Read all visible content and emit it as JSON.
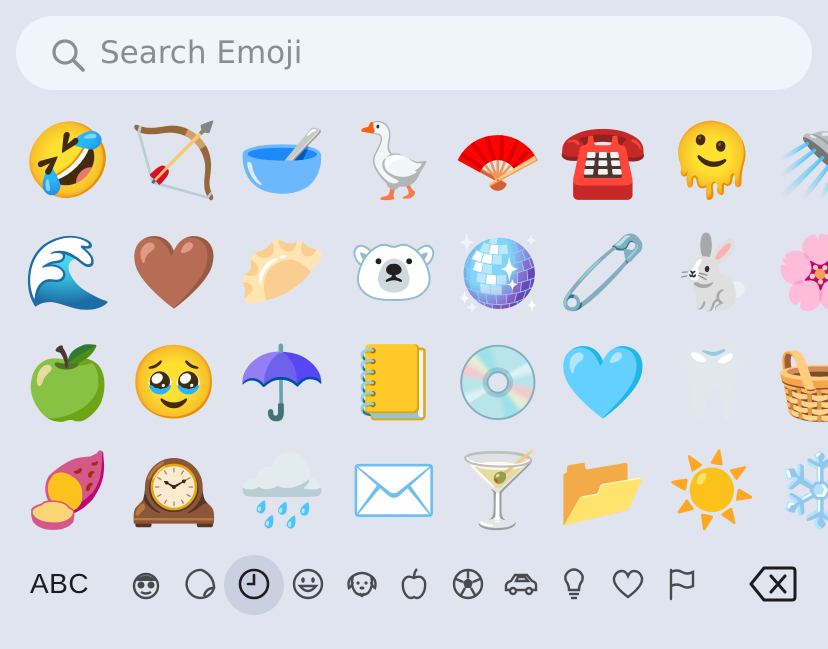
{
  "search": {
    "placeholder": "Search Emoji"
  },
  "emoji_grid": {
    "rows": [
      [
        "🤣",
        "🏹",
        "🥣",
        "🪿",
        "🪭",
        "☎️",
        "🫠",
        "🚿"
      ],
      [
        "🌊",
        "🤎",
        "🥟",
        "🐻‍❄️",
        "🪩",
        "🧷",
        "🐇",
        "🌸"
      ],
      [
        "🍏",
        "🥹",
        "☂️",
        "📒",
        "💿",
        "🩵",
        "🦷",
        "🧺"
      ],
      [
        "🍠",
        "🕰️",
        "🌧️",
        "✉️",
        "🍸",
        "📂",
        "☀️",
        "❄️"
      ]
    ]
  },
  "categories": {
    "abc_label": "ABC",
    "items": [
      {
        "name": "smileys-people",
        "icon": "person-face-icon"
      },
      {
        "name": "stickers",
        "icon": "sticker-icon"
      },
      {
        "name": "frequently-used",
        "icon": "clock-icon",
        "selected": true
      },
      {
        "name": "smileys",
        "icon": "smiley-icon"
      },
      {
        "name": "animals-nature",
        "icon": "dog-icon"
      },
      {
        "name": "food-drink",
        "icon": "apple-icon"
      },
      {
        "name": "activity",
        "icon": "soccer-ball-icon"
      },
      {
        "name": "travel-places",
        "icon": "car-icon"
      },
      {
        "name": "objects",
        "icon": "lightbulb-icon"
      },
      {
        "name": "symbols",
        "icon": "heart-icon"
      },
      {
        "name": "flags",
        "icon": "flag-icon"
      }
    ]
  },
  "colors": {
    "background": "#dfe4ee",
    "search_bg": "#f0f5fc",
    "placeholder": "#888d95",
    "icon_stroke": "#4a4a4e",
    "selected_bg": "#c9d1e0"
  }
}
